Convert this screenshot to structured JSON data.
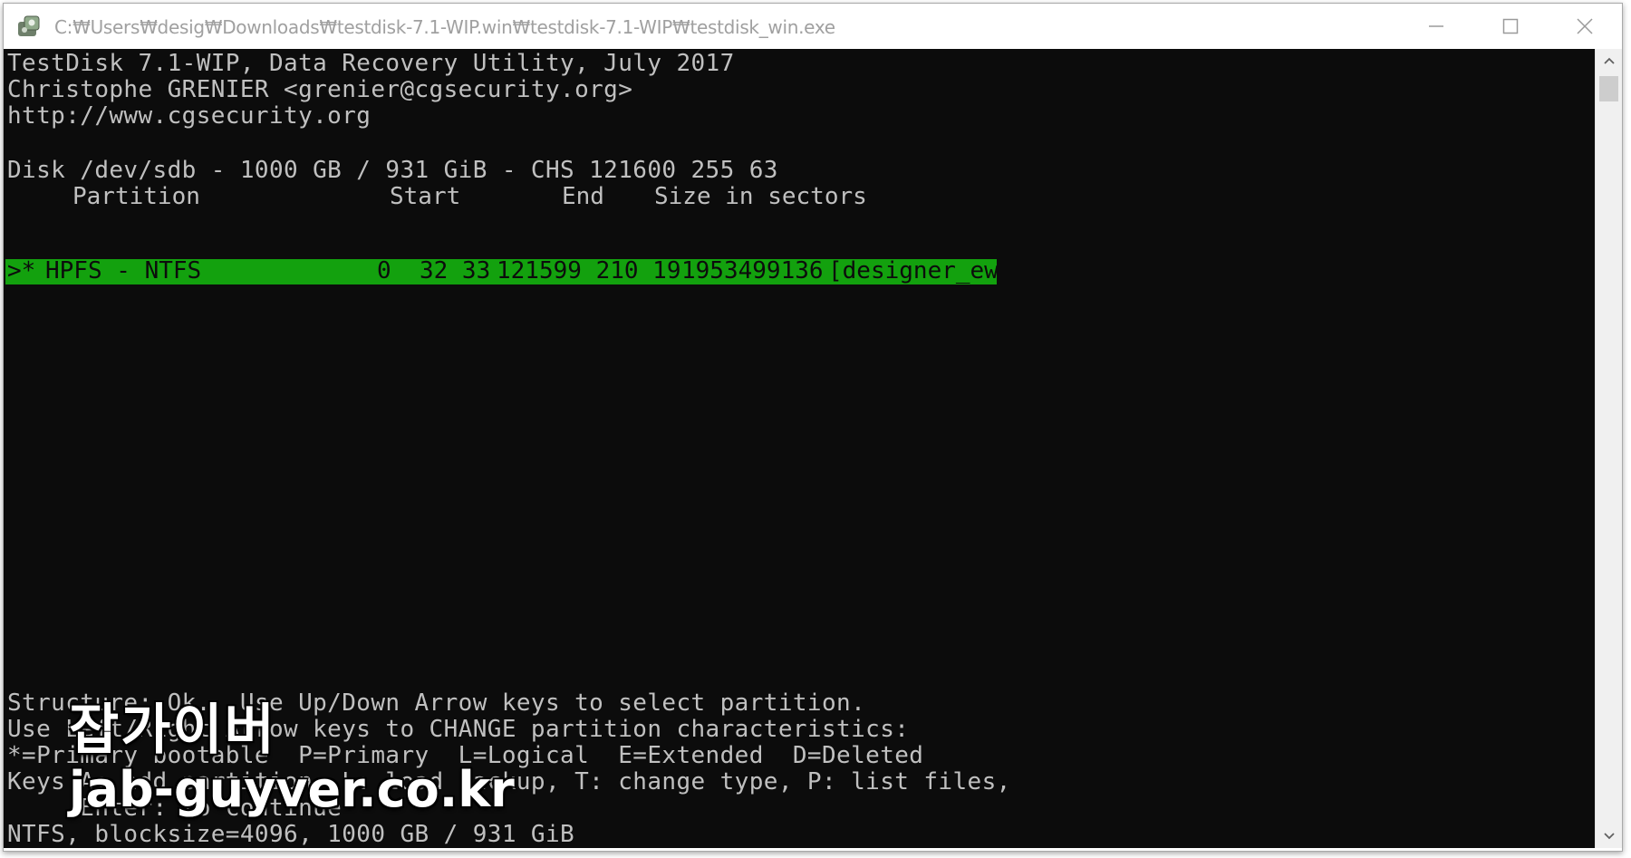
{
  "window": {
    "title": "C:₩Users₩desig₩Downloads₩testdisk-7.1-WIP.win₩testdisk-7.1-WIP₩testdisk_win.exe",
    "app_icon": "testdisk-app-icon",
    "controls": {
      "minimize_icon": "minimize-icon",
      "maximize_icon": "maximize-icon",
      "close_icon": "close-icon"
    }
  },
  "terminal": {
    "header_lines": [
      "TestDisk 7.1-WIP, Data Recovery Utility, July 2017",
      "Christophe GRENIER <grenier@cgsecurity.org>",
      "http://www.cgsecurity.org"
    ],
    "disk_line": "Disk /dev/sdb - 1000 GB / 931 GiB - CHS 121600 255 63",
    "columns": {
      "partition": "Partition",
      "start": "Start",
      "end": "End",
      "size": "Size in sectors"
    },
    "partitions": [
      {
        "marker": ">*",
        "type": "HPFS - NTFS",
        "start": "0  32 33",
        "end": "121599 210 19",
        "size": "1953499136",
        "label": "[designer_ew]",
        "selected": true
      }
    ],
    "help_lines": [
      "Structure: Ok.  Use Up/Down Arrow keys to select partition.",
      "Use Left/Right Arrow keys to CHANGE partition characteristics:",
      "*=Primary bootable  P=Primary  L=Logical  E=Extended  D=Deleted",
      "Keys A: add partition, L: load backup, T: change type, P: list files,",
      "     Enter: to continue"
    ],
    "status_line": "NTFS, blocksize=4096, 1000 GB / 931 GiB",
    "background_color": "#0c0c0c",
    "text_color": "#c0c0c0",
    "highlight_color": "#13a10e"
  },
  "watermark": {
    "korean": "잡가이버",
    "url": "jab-guyver.co.kr"
  }
}
